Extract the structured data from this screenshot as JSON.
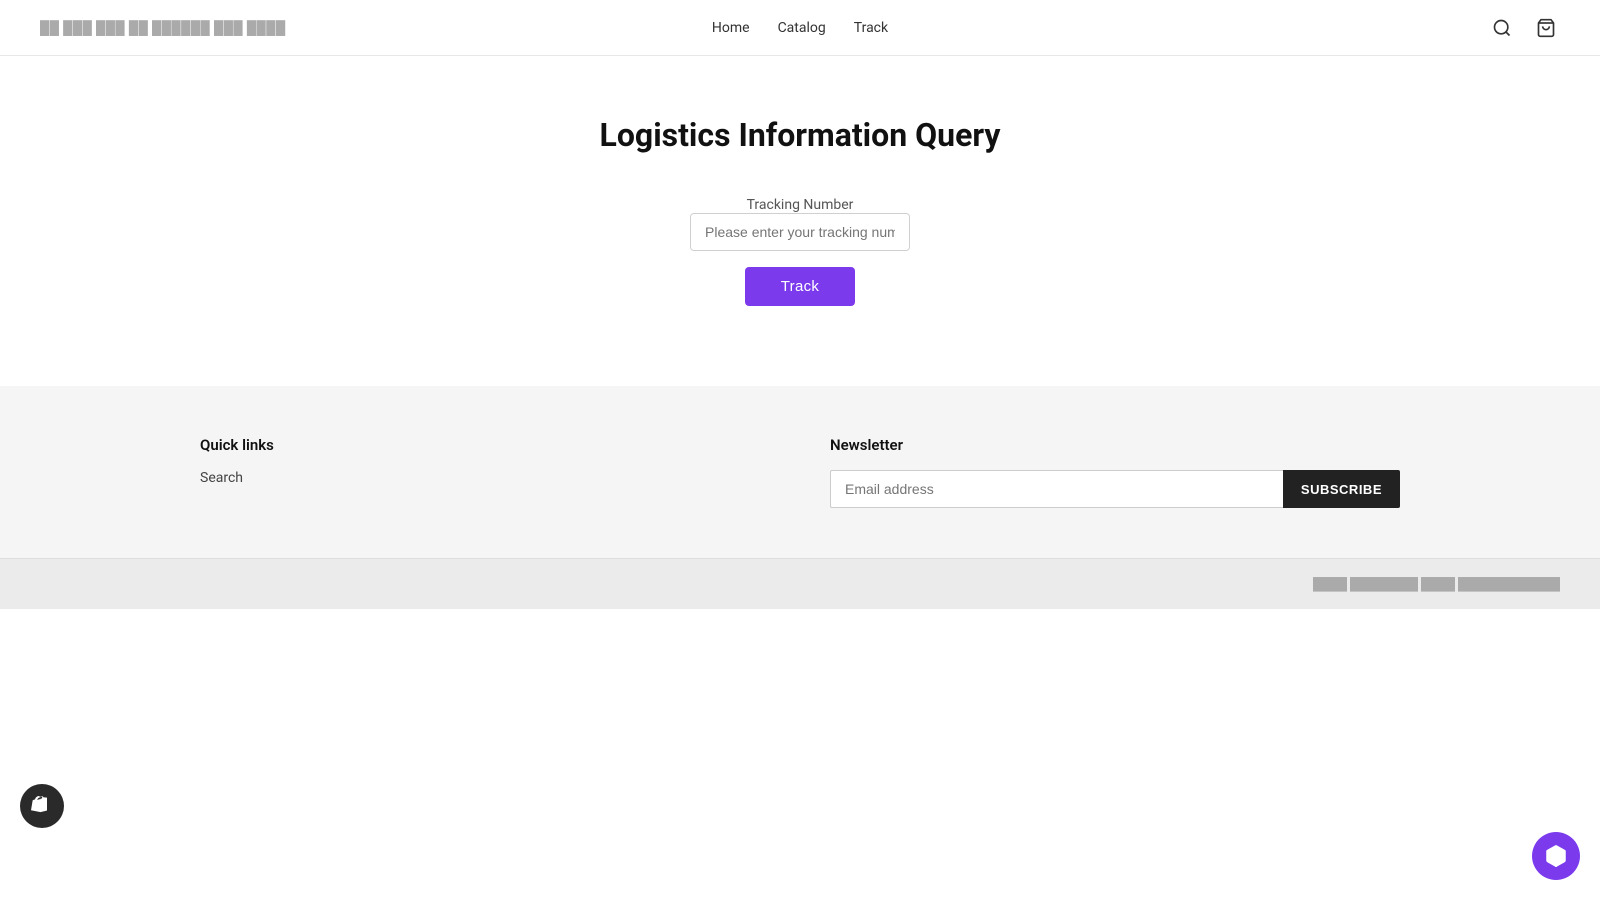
{
  "header": {
    "logo_text": "blurred store name",
    "nav": [
      {
        "label": "Home",
        "href": "#"
      },
      {
        "label": "Catalog",
        "href": "#"
      },
      {
        "label": "Track",
        "href": "#"
      }
    ],
    "search_label": "search",
    "cart_label": "cart"
  },
  "main": {
    "page_title": "Logistics Information Query",
    "tracking_label": "Tracking Number",
    "tracking_placeholder": "Please enter your tracking number",
    "track_button": "Track"
  },
  "footer": {
    "quick_links": {
      "title": "Quick links",
      "items": [
        {
          "label": "Search"
        }
      ]
    },
    "newsletter": {
      "title": "Newsletter",
      "email_placeholder": "Email address",
      "subscribe_label": "SUBSCRIBE"
    },
    "bottom_text": "© 2024 blurred copyright text"
  }
}
